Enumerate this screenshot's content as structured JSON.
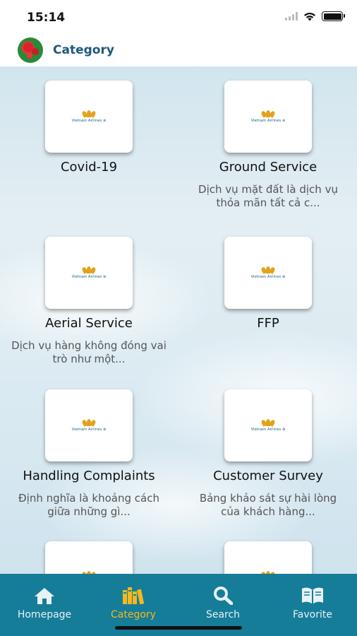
{
  "status_bar": {
    "time": "15:14"
  },
  "header": {
    "title": "Category"
  },
  "categories": [
    {
      "title": "Covid-19",
      "desc": ""
    },
    {
      "title": "Ground Service",
      "desc": "Dịch vụ mặt đất là dịch vụ thỏa mãn tất cả c..."
    },
    {
      "title": "Aerial Service",
      "desc": "Dịch vụ hàng không đóng vai trò như một..."
    },
    {
      "title": "FFP",
      "desc": ""
    },
    {
      "title": "Handling Complaints",
      "desc": "Định nghĩa là khoảng cách giữa những gì..."
    },
    {
      "title": "Customer Survey",
      "desc": "Bảng khảo sát sự hài lòng của khách hàng..."
    },
    {
      "title": "",
      "desc": ""
    },
    {
      "title": "",
      "desc": ""
    }
  ],
  "thumbnail": {
    "logo_text": "Vietnam Airlines ⊕",
    "icon": "vietnam-airlines-lotus-logo"
  },
  "tab_bar": {
    "tabs": [
      {
        "label": "Homepage",
        "icon": "home-icon"
      },
      {
        "label": "Category",
        "icon": "books-icon",
        "active": true
      },
      {
        "label": "Search",
        "icon": "search-icon"
      },
      {
        "label": "Favorite",
        "icon": "open-book-icon"
      }
    ]
  },
  "colors": {
    "accent": "#167d98",
    "active_tab": "#f5b820",
    "header_title": "#1b5a7a"
  }
}
